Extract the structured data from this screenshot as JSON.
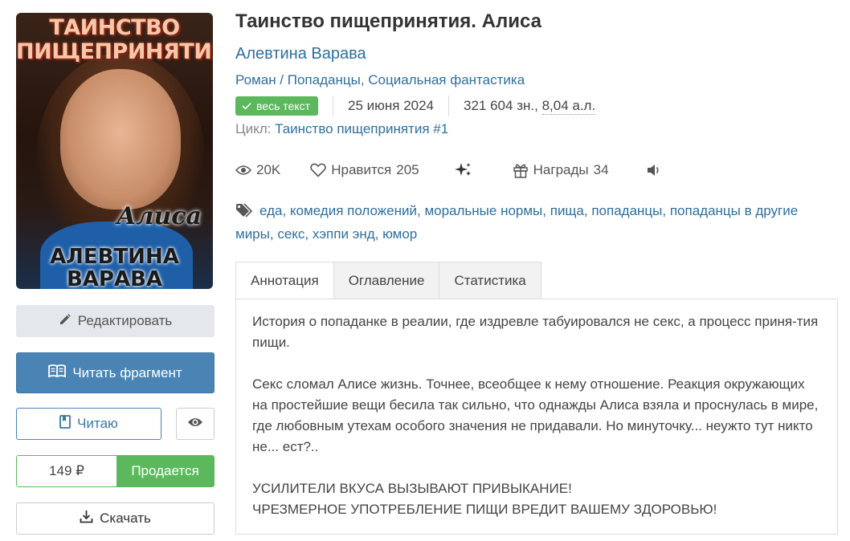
{
  "book": {
    "title": "Таинство пищепринятия. Алиса",
    "author": "Алевтина Варава",
    "genres": [
      "Роман",
      "Попаданцы",
      "Социальная фантастика"
    ],
    "status_badge": "весь текст",
    "date": "25 июня 2024",
    "size_chars": "321 604 зн.",
    "size_sheets": "8,04 а.л.",
    "cycle_label": "Цикл:",
    "cycle_name": "Таинство пищепринятия #1"
  },
  "cover": {
    "title_line1": "ТАИНСТВО",
    "title_line2": "ПИЩЕПРИНЯТИЯ",
    "subtitle": "Алиса",
    "author_line1": "АЛЕВТИНА",
    "author_line2": "ВАРАВА"
  },
  "stats": {
    "views": "20K",
    "likes_label": "Нравится",
    "likes_count": "205",
    "awards_label": "Награды",
    "awards_count": "34"
  },
  "tags": [
    "еда",
    "комедия положений",
    "моральные нормы",
    "пища",
    "попаданцы",
    "попаданцы в другие миры",
    "секс",
    "хэппи энд",
    "юмор"
  ],
  "actions": {
    "edit": "Редактировать",
    "read_fragment": "Читать фрагмент",
    "reading": "Читаю",
    "price": "149 ₽",
    "for_sale": "Продается",
    "download": "Скачать"
  },
  "tabs": [
    "Аннотация",
    "Оглавление",
    "Статистика"
  ],
  "annotation": {
    "p1": "История о попаданке в реалии, где издревле табуировался не секс, а процесс приня-тия пищи.",
    "p2": "Секс сломал Алисе жизнь. Точнее, всеобщее к нему отношение. Реакция окружающих на простейшие вещи бесила так сильно, что однажды Алиса взяла и проснулась в мире, где любовным утехам особого значения не придавали. Но минуточку... неужто тут никто не... ест?..",
    "p3_line1": "УСИЛИТЕЛИ ВКУСА ВЫЗЫВАЮТ ПРИВЫКАНИЕ!",
    "p3_line2": "ЧРЕЗМЕРНОЕ УПОТРЕБЛЕНИЕ ПИЩИ ВРЕДИТ ВАШЕМУ ЗДОРОВЬЮ!"
  },
  "colors": {
    "link": "#2f6f9f",
    "primary": "#4a84b5",
    "success": "#5cb85c"
  }
}
